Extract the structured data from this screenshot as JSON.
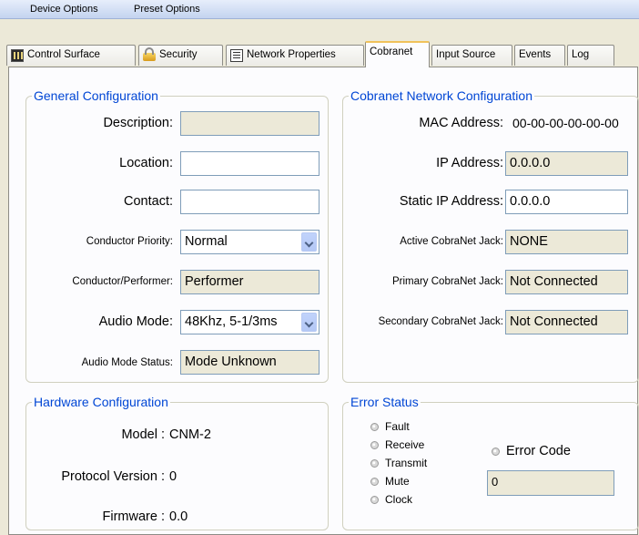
{
  "menu": [
    "Device Options",
    "Preset Options"
  ],
  "tabs": [
    {
      "label": "Control Surface",
      "icon": "control-surface-icon"
    },
    {
      "label": "Security",
      "icon": "lock-icon"
    },
    {
      "label": "Network Properties",
      "icon": "network-properties-icon"
    },
    {
      "label": "Cobranet",
      "active": true
    },
    {
      "label": "Input Source"
    },
    {
      "label": "Events"
    },
    {
      "label": "Log"
    }
  ],
  "general": {
    "title": "General Configuration",
    "description_label": "Description:",
    "description_value": "",
    "location_label": "Location:",
    "location_value": "",
    "contact_label": "Contact:",
    "contact_value": "",
    "conductor_priority_label": "Conductor Priority:",
    "conductor_priority_value": "Normal",
    "conductor_performer_label": "Conductor/Performer:",
    "conductor_performer_value": "Performer",
    "audio_mode_label": "Audio Mode:",
    "audio_mode_value": "48Khz, 5-1/3ms",
    "audio_mode_status_label": "Audio Mode Status:",
    "audio_mode_status_value": "Mode Unknown"
  },
  "network": {
    "title": "Cobranet Network Configuration",
    "mac_label": "MAC Address:",
    "mac_value": "00-00-00-00-00-00",
    "ip_label": "IP Address:",
    "ip_value": "0.0.0.0",
    "static_ip_label": "Static IP Address:",
    "static_ip_value": "0.0.0.0",
    "active_jack_label": "Active CobraNet Jack:",
    "active_jack_value": "NONE",
    "primary_jack_label": "Primary CobraNet Jack:",
    "primary_jack_value": "Not Connected",
    "secondary_jack_label": "Secondary CobraNet Jack:",
    "secondary_jack_value": "Not Connected"
  },
  "hardware": {
    "title": "Hardware Configuration",
    "model_label": "Model :",
    "model_value": "CNM-2",
    "protocol_label": "Protocol Version :",
    "protocol_value": "0",
    "firmware_label": "Firmware :",
    "firmware_value": "0.0"
  },
  "error_status": {
    "title": "Error Status",
    "indicators": [
      "Fault",
      "Receive",
      "Transmit",
      "Mute",
      "Clock"
    ],
    "error_code_label": "Error Code",
    "error_code_value": "0"
  },
  "colors": {
    "group_title": "#0046d5",
    "active_tab_highlight": "#f0c25b",
    "readonly_field": "#ece9d8"
  }
}
